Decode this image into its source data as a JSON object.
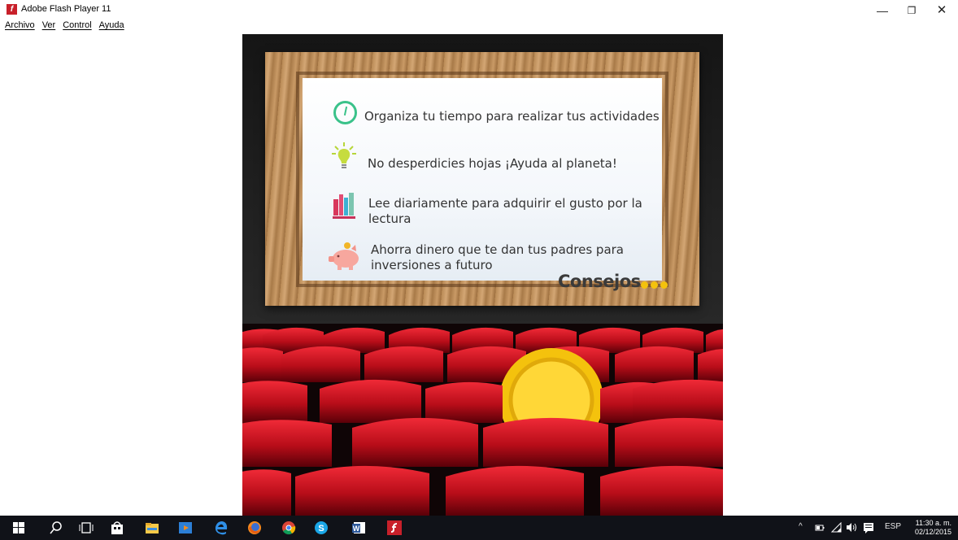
{
  "window": {
    "title": "Adobe Flash Player 11",
    "app_icon_glyph": "f",
    "minimize_glyph": "—",
    "maximize_glyph": "❐",
    "close_glyph": "✕"
  },
  "menu": {
    "items": [
      {
        "label": "Archivo"
      },
      {
        "label": "Ver"
      },
      {
        "label": "Control"
      },
      {
        "label": "Ayuda"
      }
    ]
  },
  "board": {
    "tips": [
      {
        "text": "Organiza tu tiempo para realizar tus actividades",
        "icon": "clock-icon"
      },
      {
        "text": "No desperdicies hojas ¡Ayuda al planeta!",
        "icon": "lightbulb-icon"
      },
      {
        "text": "Lee diariamente para adquirir el gusto por la lectura",
        "icon": "books-icon"
      },
      {
        "text": "Ahorra dinero que te dan tus padres para inversiones a futuro",
        "icon": "piggy-bank-icon"
      }
    ],
    "heading": "Consejos",
    "accent_color": "#f4c20d"
  },
  "scene": {
    "seat_color": "#c8101e",
    "coin_color": "#f4c20d"
  },
  "taskbar": {
    "icons": [
      "windows-start-icon",
      "search-icon",
      "task-view-icon",
      "store-icon",
      "file-explorer-icon",
      "media-icon",
      "edge-icon",
      "firefox-icon",
      "chrome-icon",
      "skype-icon",
      "word-icon",
      "flash-player-icon"
    ],
    "tray": {
      "chevron": "^",
      "language": "ESP",
      "time": "11:30 a. m.",
      "date": "02/12/2015"
    }
  }
}
